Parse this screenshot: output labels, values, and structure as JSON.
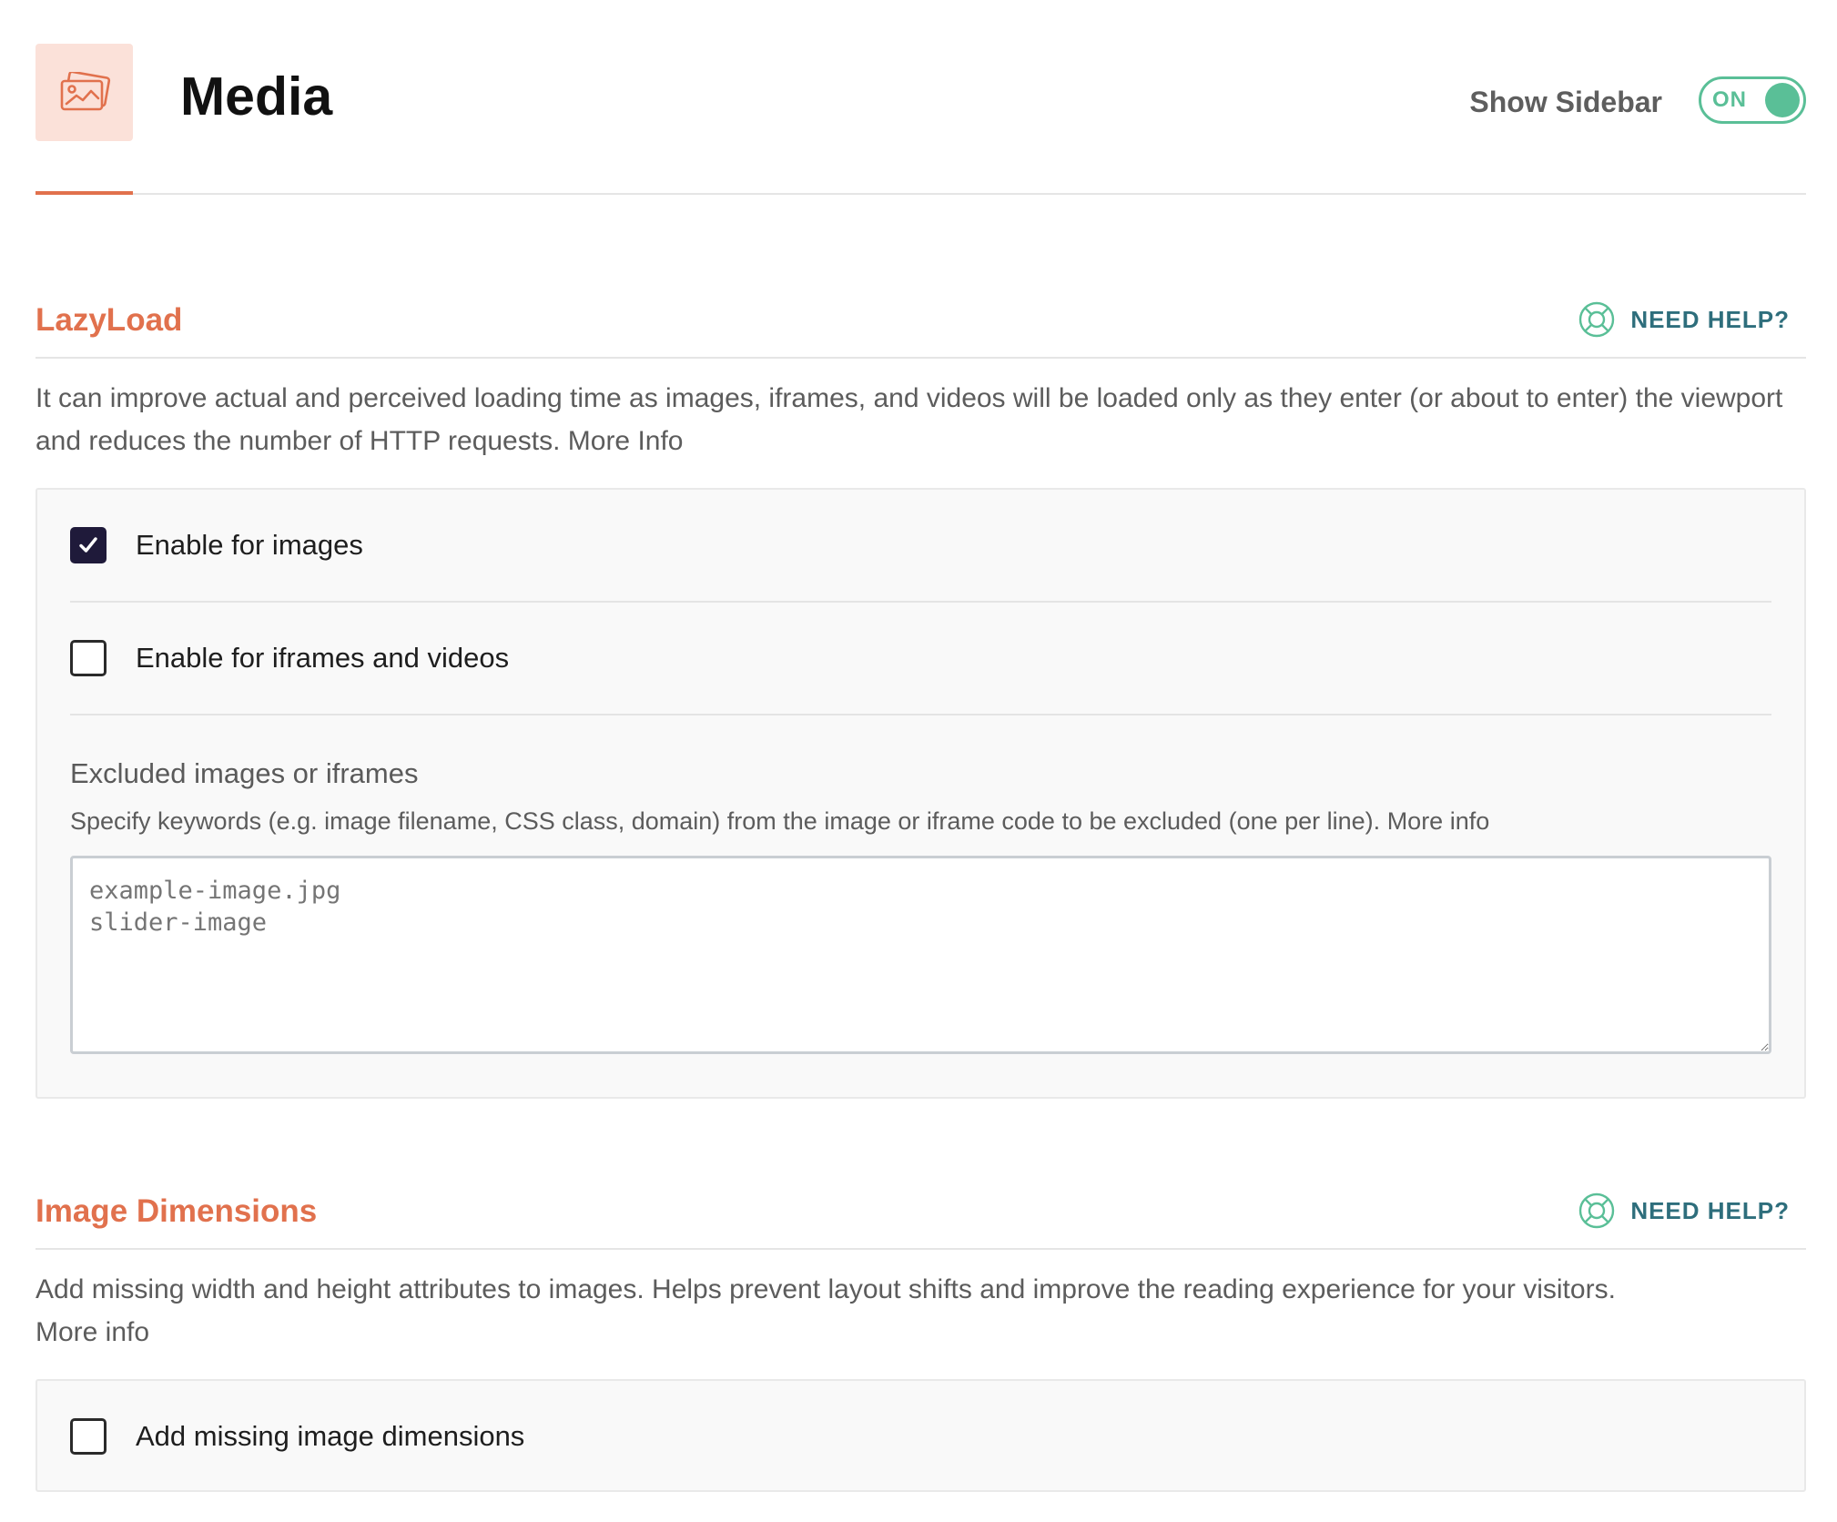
{
  "header": {
    "title": "Media",
    "icon": "media-images-icon",
    "sidebar_label": "Show Sidebar",
    "sidebar_toggle": "ON"
  },
  "colors": {
    "accent": "#e1714d",
    "accent_light": "#fbe1d9",
    "toggle_on": "#5abf97",
    "help": "#2e6e7c",
    "checkbox_checked": "#1f1a3a"
  },
  "lazyload": {
    "title": "LazyLoad",
    "help": "NEED HELP?",
    "description": "It can improve actual and perceived loading time as images, iframes, and videos will be loaded only as they enter (or about to enter) the viewport and reduces the number of HTTP requests.",
    "more_info": "More Info",
    "options": [
      {
        "label": "Enable for images",
        "checked": true
      },
      {
        "label": "Enable for iframes and videos",
        "checked": false
      }
    ],
    "exclude": {
      "title": "Excluded images or iframes",
      "description": "Specify keywords (e.g. image filename, CSS class, domain) from the image or iframe code to be excluded (one per line).",
      "more_info": "More info",
      "placeholder": "example-image.jpg\nslider-image"
    }
  },
  "image_dimensions": {
    "title": "Image Dimensions",
    "help": "NEED HELP?",
    "description": "Add missing width and height attributes to images. Helps prevent layout shifts and improve the reading experience for your visitors.",
    "more_info": "More info",
    "options": [
      {
        "label": "Add missing image dimensions",
        "checked": false
      }
    ]
  }
}
